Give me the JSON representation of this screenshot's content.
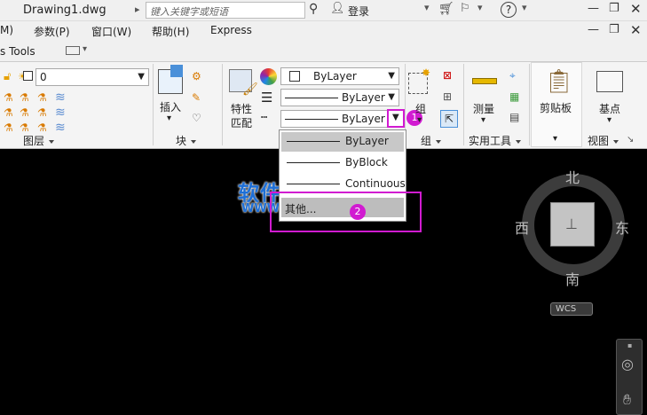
{
  "window": {
    "title": "Drawing1.dwg",
    "search_placeholder": "键入关键字或短语",
    "login_label": "登录"
  },
  "menu": {
    "items": [
      "M)",
      "参数(P)",
      "窗口(W)",
      "帮助(H)",
      "Express"
    ]
  },
  "tabs": {
    "label": "s Tools"
  },
  "ribbon": {
    "layer_value": "0",
    "layer_panel_label": "图层",
    "insert_label": "插入",
    "block_panel_label": "块",
    "match_label_1": "特性",
    "match_label_2": "匹配",
    "color_value": "ByLayer",
    "linetype_value": "ByLayer",
    "lineweight_value": "ByLayer",
    "group_label": "组",
    "group_panel_label": "组",
    "measure_label": "测量",
    "utilities_panel_label": "实用工具",
    "clipboard_label": "剪贴板",
    "basepoint_label": "基点",
    "view_panel_label": "视图"
  },
  "dropdown": {
    "items": [
      "ByLayer",
      "ByBlock",
      "Continuous",
      "其他..."
    ]
  },
  "annotations": {
    "marker_1": "1",
    "marker_2": "2"
  },
  "watermark": {
    "title": "软件自学网",
    "url": "WWW.RJZXW.COM"
  },
  "viewcube": {
    "north": "北",
    "south": "南",
    "east": "东",
    "west": "西",
    "wcs": "WCS"
  },
  "colors": {
    "accent_magenta": "#d11bd1",
    "watermark_blue": "#1e6fd6"
  }
}
